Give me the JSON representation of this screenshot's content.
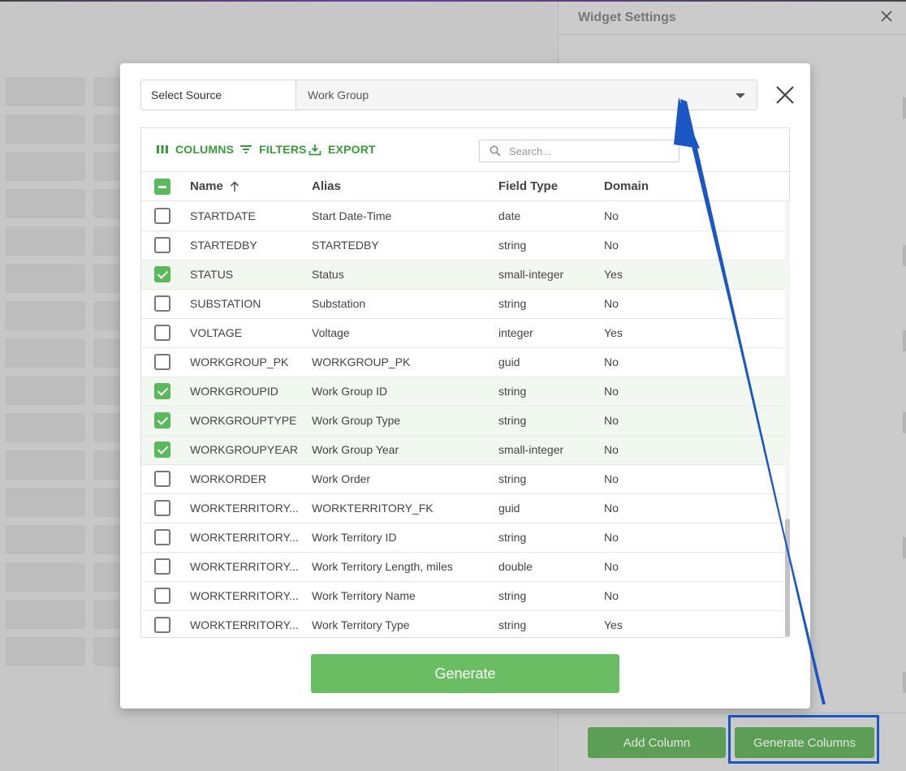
{
  "panel": {
    "title": "Widget Settings",
    "add_column_label": "Add Column",
    "generate_columns_label": "Generate Columns"
  },
  "modal": {
    "source_label": "Select Source",
    "source_value": "Work Group",
    "toolbar": {
      "columns": "COLUMNS",
      "filters": "FILTERS",
      "export": "EXPORT"
    },
    "search_placeholder": "Search...",
    "headers": {
      "name": "Name",
      "alias": "Alias",
      "field_type": "Field Type",
      "domain": "Domain"
    },
    "rows": [
      {
        "checked": false,
        "name": "STARTDATE",
        "alias": "Start Date-Time",
        "type": "date",
        "domain": "No"
      },
      {
        "checked": false,
        "name": "STARTEDBY",
        "alias": "STARTEDBY",
        "type": "string",
        "domain": "No"
      },
      {
        "checked": true,
        "name": "STATUS",
        "alias": "Status",
        "type": "small-integer",
        "domain": "Yes"
      },
      {
        "checked": false,
        "name": "SUBSTATION",
        "alias": "Substation",
        "type": "string",
        "domain": "No"
      },
      {
        "checked": false,
        "name": "VOLTAGE",
        "alias": "Voltage",
        "type": "integer",
        "domain": "Yes"
      },
      {
        "checked": false,
        "name": "WORKGROUP_PK",
        "alias": "WORKGROUP_PK",
        "type": "guid",
        "domain": "No"
      },
      {
        "checked": true,
        "name": "WORKGROUPID",
        "alias": "Work Group ID",
        "type": "string",
        "domain": "No"
      },
      {
        "checked": true,
        "name": "WORKGROUPTYPE",
        "alias": "Work Group Type",
        "type": "string",
        "domain": "No"
      },
      {
        "checked": true,
        "name": "WORKGROUPYEAR",
        "alias": "Work Group Year",
        "type": "small-integer",
        "domain": "No"
      },
      {
        "checked": false,
        "name": "WORKORDER",
        "alias": "Work Order",
        "type": "string",
        "domain": "No"
      },
      {
        "checked": false,
        "name": "WORKTERRITORY...",
        "alias": "WORKTERRITORY_FK",
        "type": "guid",
        "domain": "No"
      },
      {
        "checked": false,
        "name": "WORKTERRITORY...",
        "alias": "Work Territory ID",
        "type": "string",
        "domain": "No"
      },
      {
        "checked": false,
        "name": "WORKTERRITORY...",
        "alias": "Work Territory Length, miles",
        "type": "double",
        "domain": "No"
      },
      {
        "checked": false,
        "name": "WORKTERRITORY...",
        "alias": "Work Territory Name",
        "type": "string",
        "domain": "No"
      },
      {
        "checked": false,
        "name": "WORKTERRITORY...",
        "alias": "Work Territory Type",
        "type": "string",
        "domain": "Yes"
      }
    ],
    "generate_label": "Generate"
  },
  "colors": {
    "accent_green": "#5cb85c",
    "button_green": "#6abd62",
    "annotation_blue": "#1a56c4"
  }
}
